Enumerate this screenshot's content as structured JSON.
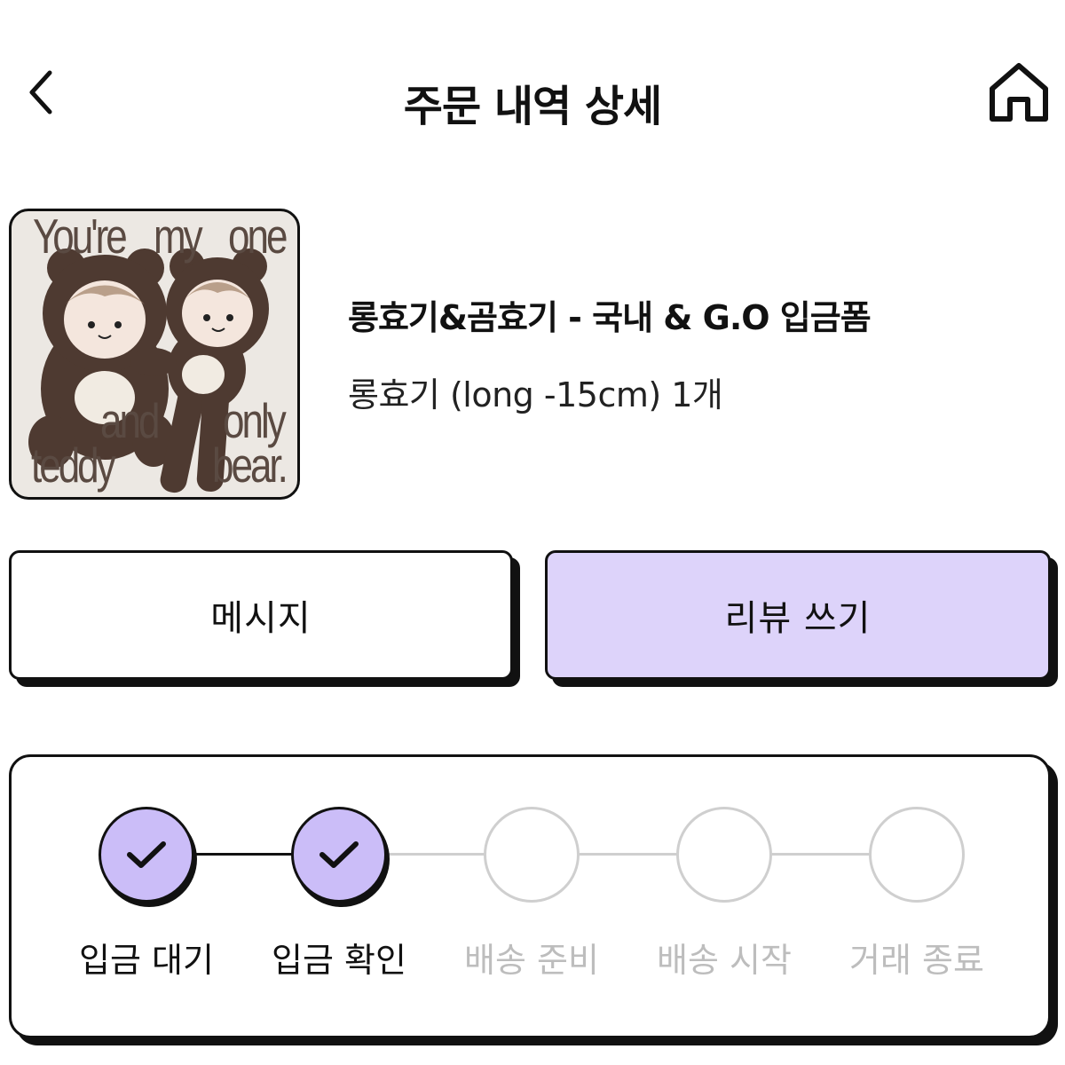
{
  "header": {
    "title": "주문 내역 상세",
    "back_icon": "chevron-left-icon",
    "home_icon": "home-icon"
  },
  "product": {
    "name": "롱효기&곰효기 - 국내 & G.O 입금폼",
    "option": "롱효기 (long -15cm) 1개",
    "image_text": {
      "line1a": "You're",
      "line1b": "my",
      "line1c": "one",
      "mid": "and",
      "line2a": "teddy",
      "line2b": "only",
      "line2c": "bear."
    }
  },
  "actions": {
    "message_label": "메시지",
    "review_label": "리뷰 쓰기"
  },
  "progress": {
    "steps": [
      {
        "label": "입금 대기",
        "status": "done"
      },
      {
        "label": "입금 확인",
        "status": "done"
      },
      {
        "label": "배송 준비",
        "status": "pending"
      },
      {
        "label": "배송 시작",
        "status": "pending"
      },
      {
        "label": "거래 종료",
        "status": "pending"
      }
    ],
    "completed_count": 2
  },
  "colors": {
    "accent": "#ddd3fa",
    "step_done": "#cbbdf8",
    "step_pending_border": "#cfcfcf",
    "step_pending_text": "#bdbdbd",
    "border": "#111111"
  }
}
